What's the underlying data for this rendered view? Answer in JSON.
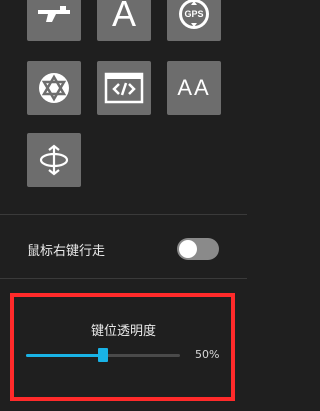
{
  "icons": [
    {
      "name": "gun-icon"
    },
    {
      "name": "text-a-icon",
      "glyph": "A"
    },
    {
      "name": "gps-icon",
      "glyph": "GPS"
    },
    {
      "name": "star-of-david-icon"
    },
    {
      "name": "code-window-icon"
    },
    {
      "name": "double-a-icon",
      "glyph": "AA"
    },
    {
      "name": "rotate-icon"
    }
  ],
  "settings": {
    "mouse_right_walk_label": "鼠标右键行走",
    "mouse_right_walk_enabled": false
  },
  "opacity_control": {
    "title": "键位透明度",
    "value_text": "50%",
    "value_fraction": 0.5
  },
  "colors": {
    "accent": "#19b3e6",
    "highlight": "#ff2a2a",
    "tile": "#6d6d6d"
  }
}
